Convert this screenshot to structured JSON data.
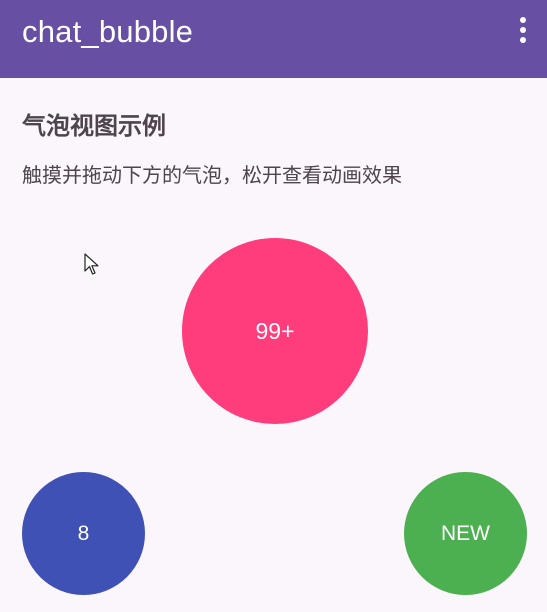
{
  "app_bar": {
    "title": "chat_bubble",
    "overflow_icon": "more-vert-icon",
    "background_color": "#6750a4"
  },
  "content": {
    "heading": "气泡视图示例",
    "description": "触摸并拖动下方的气泡，松开查看动画效果"
  },
  "bubbles": {
    "main": {
      "label": "99+",
      "color": "#ff3d7d"
    },
    "left": {
      "label": "8",
      "color": "#3f51b5"
    },
    "right": {
      "label": "NEW",
      "color": "#4caf50"
    }
  },
  "cursor": {
    "icon": "mouse-pointer-icon"
  }
}
